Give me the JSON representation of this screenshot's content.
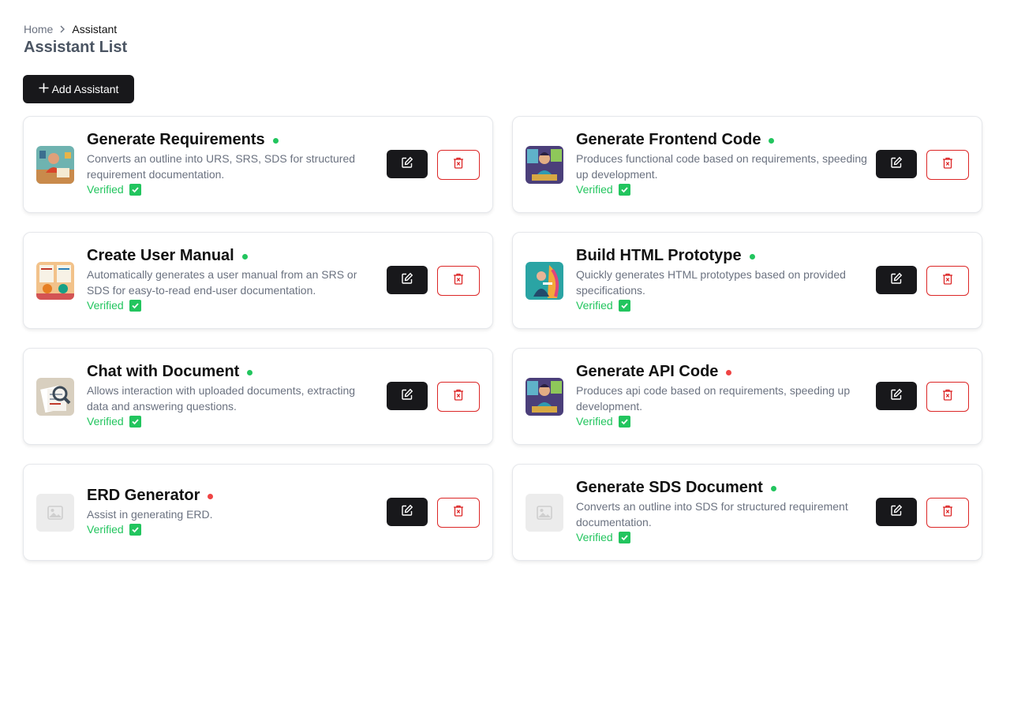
{
  "breadcrumb": {
    "home": "Home",
    "current": "Assistant"
  },
  "page_title": "Assistant List",
  "add_button_label": "Add Assistant",
  "colors": {
    "active": "#22c55e",
    "inactive": "#ef4444",
    "verified": "#22c55e",
    "danger": "#dc2626",
    "primary": "#18181b"
  },
  "assistants": [
    {
      "title": "Generate Requirements",
      "status": "active",
      "desc": "Converts an outline into URS, SRS, SDS for structured requirement documentation.",
      "verified_label": "Verified",
      "image": "illustration-person-writing"
    },
    {
      "title": "Generate Frontend Code",
      "status": "active",
      "desc": "Produces functional code based on requirements, speeding up development.",
      "verified_label": "Verified",
      "image": "illustration-coder"
    },
    {
      "title": "Create User Manual",
      "status": "active",
      "desc": "Automatically generates a user manual from an SRS or SDS for easy-to-read end-user documentation.",
      "verified_label": "Verified",
      "image": "illustration-manual"
    },
    {
      "title": "Build HTML Prototype",
      "status": "active",
      "desc": "Quickly generates HTML prototypes based on provided specifications.",
      "verified_label": "Verified",
      "image": "illustration-artist"
    },
    {
      "title": "Chat with Document",
      "status": "active",
      "desc": "Allows interaction with uploaded documents, extracting data and answering questions.",
      "verified_label": "Verified",
      "image": "illustration-document-magnifier"
    },
    {
      "title": "Generate API Code",
      "status": "inactive",
      "desc": "Produces api code based on requirements, speeding up development.",
      "verified_label": "Verified",
      "image": "illustration-coder"
    },
    {
      "title": "ERD Generator",
      "status": "inactive",
      "desc": "Assist in generating ERD.",
      "verified_label": "Verified",
      "image": "placeholder"
    },
    {
      "title": "Generate SDS Document",
      "status": "active",
      "desc": "Converts an outline into SDS for structured requirement documentation.",
      "verified_label": "Verified",
      "image": "placeholder"
    }
  ]
}
